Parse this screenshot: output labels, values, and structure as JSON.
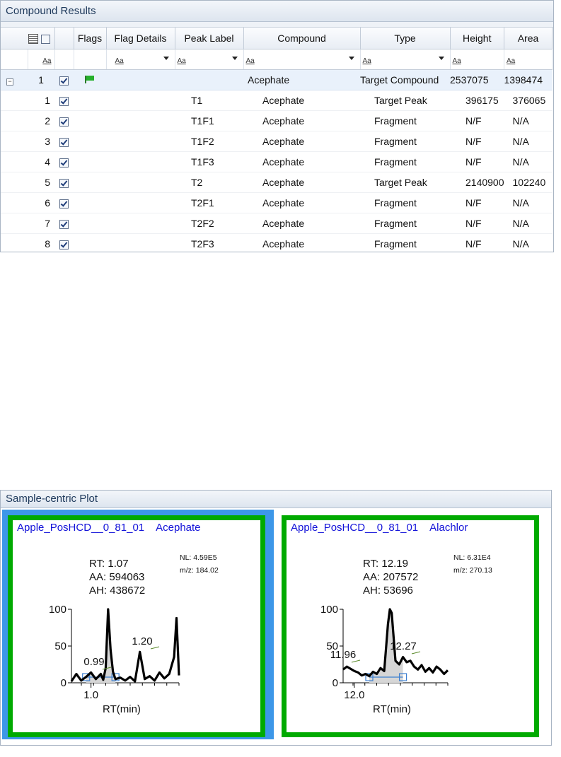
{
  "results": {
    "title": "Compound Results",
    "headers": [
      "Flags",
      "Flag Details",
      "Peak Label",
      "Compound",
      "Type",
      "Height",
      "Area"
    ],
    "filter_token": "Aa",
    "parent": {
      "index": "1",
      "compound": "Acephate",
      "type": "Target Compound",
      "height": "2537075",
      "area": "1398474"
    },
    "rows": [
      {
        "idx": "1",
        "label": "T1",
        "compound": "Acephate",
        "type": "Target Peak",
        "height": "396175",
        "area": "376065"
      },
      {
        "idx": "2",
        "label": "T1F1",
        "compound": "Acephate",
        "type": "Fragment",
        "height": "N/F",
        "area": "N/A"
      },
      {
        "idx": "3",
        "label": "T1F2",
        "compound": "Acephate",
        "type": "Fragment",
        "height": "N/F",
        "area": "N/A"
      },
      {
        "idx": "4",
        "label": "T1F3",
        "compound": "Acephate",
        "type": "Fragment",
        "height": "N/F",
        "area": "N/A"
      },
      {
        "idx": "5",
        "label": "T2",
        "compound": "Acephate",
        "type": "Target Peak",
        "height": "2140900",
        "area": "102240"
      },
      {
        "idx": "6",
        "label": "T2F1",
        "compound": "Acephate",
        "type": "Fragment",
        "height": "N/F",
        "area": "N/A"
      },
      {
        "idx": "7",
        "label": "T2F2",
        "compound": "Acephate",
        "type": "Fragment",
        "height": "N/F",
        "area": "N/A"
      },
      {
        "idx": "8",
        "label": "T2F3",
        "compound": "Acephate",
        "type": "Fragment",
        "height": "N/F",
        "area": "N/A"
      }
    ]
  },
  "plots": {
    "title": "Sample-centric Plot",
    "left": {
      "sample": "Apple_PosHCD__0_81_01",
      "compound": "Acephate",
      "nl": "NL: 4.59E5",
      "mz": "m/z: 184.02",
      "rt": "RT: 1.07",
      "aa": "AA: 594063",
      "ah": "AH: 438672",
      "y_ticks": [
        "100",
        "50",
        "0"
      ],
      "x_tick": "1.0",
      "xlabel": "RT(min)",
      "peak_labels": [
        "0.99",
        "1.20"
      ]
    },
    "right": {
      "sample": "Apple_PosHCD__0_81_01",
      "compound": "Alachlor",
      "nl": "NL: 6.31E4",
      "mz": "m/z: 270.13",
      "rt": "RT: 12.19",
      "aa": "AA: 207572",
      "ah": "AH: 53696",
      "y_ticks": [
        "100",
        "50",
        "0"
      ],
      "x_tick": "12.0",
      "xlabel": "RT(min)",
      "peak_labels": [
        "11.96",
        "12.27"
      ]
    }
  },
  "chart_data": [
    {
      "type": "line",
      "title": "Apple_PosHCD__0_81_01 Acephate",
      "xlabel": "RT(min)",
      "ylabel": "",
      "xlim": [
        0.92,
        1.36
      ],
      "ylim": [
        0,
        100
      ],
      "x": [
        0.92,
        0.94,
        0.96,
        0.98,
        1.0,
        1.02,
        1.04,
        1.05,
        1.06,
        1.07,
        1.08,
        1.09,
        1.1,
        1.12,
        1.14,
        1.16,
        1.18,
        1.2,
        1.22,
        1.24,
        1.26,
        1.28,
        1.3,
        1.32,
        1.34,
        1.35,
        1.36
      ],
      "y": [
        2,
        12,
        3,
        8,
        14,
        5,
        12,
        4,
        20,
        100,
        45,
        15,
        5,
        7,
        3,
        8,
        2,
        42,
        5,
        9,
        3,
        14,
        6,
        12,
        35,
        88,
        10
      ]
    },
    {
      "type": "line",
      "title": "Apple_PosHCD__0_81_01 Alachlor",
      "xlabel": "RT(min)",
      "ylabel": "",
      "xlim": [
        11.94,
        12.5
      ],
      "ylim": [
        0,
        100
      ],
      "x": [
        11.94,
        11.96,
        11.98,
        12.0,
        12.02,
        12.04,
        12.06,
        12.08,
        12.1,
        12.12,
        12.14,
        12.16,
        12.18,
        12.19,
        12.2,
        12.22,
        12.24,
        12.26,
        12.28,
        12.3,
        12.32,
        12.34,
        12.36,
        12.38,
        12.4,
        12.42,
        12.44,
        12.46,
        12.48,
        12.5
      ],
      "y": [
        18,
        22,
        19,
        16,
        14,
        10,
        12,
        9,
        15,
        12,
        20,
        16,
        80,
        100,
        95,
        30,
        25,
        35,
        28,
        30,
        22,
        18,
        24,
        15,
        20,
        14,
        22,
        18,
        12,
        17
      ]
    }
  ]
}
